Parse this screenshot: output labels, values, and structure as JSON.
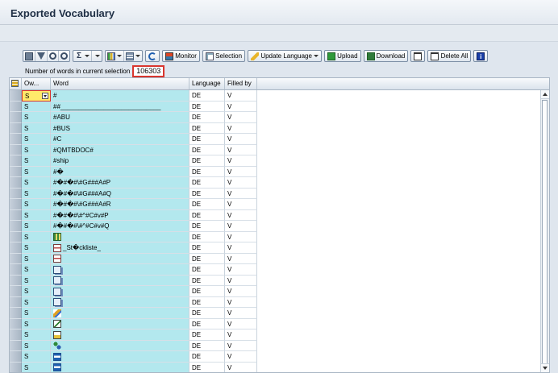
{
  "window": {
    "title": "Exported Vocabulary"
  },
  "toolbar": {
    "monitor_label": "Monitor",
    "selection_label": "Selection",
    "update_language_label": "Update Language",
    "upload_label": "Upload",
    "download_label": "Download",
    "delete_all_label": "Delete All"
  },
  "selection_info": {
    "label": "Number of words in current selection",
    "count": "106303"
  },
  "table": {
    "columns": [
      "Ow...",
      "Word",
      "Language",
      "Filled by"
    ],
    "rows": [
      {
        "owner": "S",
        "word": "#",
        "language": "DE",
        "filled_by": "V"
      },
      {
        "owner": "S",
        "word": "##____________________________",
        "language": "DE",
        "filled_by": "V"
      },
      {
        "owner": "S",
        "word": "#ABU",
        "language": "DE",
        "filled_by": "V"
      },
      {
        "owner": "S",
        "word": "#BUS",
        "language": "DE",
        "filled_by": "V"
      },
      {
        "owner": "S",
        "word": "#C",
        "language": "DE",
        "filled_by": "V"
      },
      {
        "owner": "S",
        "word": "#QMTBDOC#",
        "language": "DE",
        "filled_by": "V"
      },
      {
        "owner": "S",
        "word": "#ship",
        "language": "DE",
        "filled_by": "V"
      },
      {
        "owner": "S",
        "word": "#�",
        "language": "DE",
        "filled_by": "V"
      },
      {
        "owner": "S",
        "word": "#�#�#\\#G###A#P",
        "language": "DE",
        "filled_by": "V"
      },
      {
        "owner": "S",
        "word": "#�#�#\\#G###A#Q",
        "language": "DE",
        "filled_by": "V"
      },
      {
        "owner": "S",
        "word": "#�#�#\\#G###A#R",
        "language": "DE",
        "filled_by": "V"
      },
      {
        "owner": "S",
        "word": "#�#�#\\#^#C#v#P",
        "language": "DE",
        "filled_by": "V"
      },
      {
        "owner": "S",
        "word": "#�#�#\\#^#C#v#Q",
        "language": "DE",
        "filled_by": "V"
      },
      {
        "owner": "S",
        "word": "",
        "icon": "table-grid-icon",
        "language": "DE",
        "filled_by": "V"
      },
      {
        "owner": "S",
        "word": "_St�ckliste_",
        "icon": "hierarchy-icon",
        "language": "DE",
        "filled_by": "V"
      },
      {
        "owner": "S",
        "word": "",
        "icon": "hierarchy-icon",
        "language": "DE",
        "filled_by": "V"
      },
      {
        "owner": "S",
        "word": "",
        "icon": "copy-icon",
        "language": "DE",
        "filled_by": "V"
      },
      {
        "owner": "S",
        "word": "",
        "icon": "copy-icon",
        "language": "DE",
        "filled_by": "V"
      },
      {
        "owner": "S",
        "word": "",
        "icon": "copy-icon",
        "language": "DE",
        "filled_by": "V"
      },
      {
        "owner": "S",
        "word": "",
        "icon": "copy-icon",
        "language": "DE",
        "filled_by": "V"
      },
      {
        "owner": "S",
        "word": "",
        "icon": "checkmark-pen-icon",
        "language": "DE",
        "filled_by": "V"
      },
      {
        "owner": "S",
        "word": "",
        "icon": "edit-document-icon",
        "language": "DE",
        "filled_by": "V"
      },
      {
        "owner": "S",
        "word": "",
        "icon": "edit-note-icon",
        "language": "DE",
        "filled_by": "V"
      },
      {
        "owner": "S",
        "word": "",
        "icon": "nodes-icon",
        "language": "DE",
        "filled_by": "V"
      },
      {
        "owner": "S",
        "word": "",
        "icon": "structure-icon",
        "language": "DE",
        "filled_by": "V"
      },
      {
        "owner": "S",
        "word": "",
        "icon": "structure-icon",
        "language": "DE",
        "filled_by": "V"
      }
    ]
  },
  "colors": {
    "highlight": "#b3e8ee",
    "focus": "#ffe96a",
    "callout": "#d9362e"
  }
}
